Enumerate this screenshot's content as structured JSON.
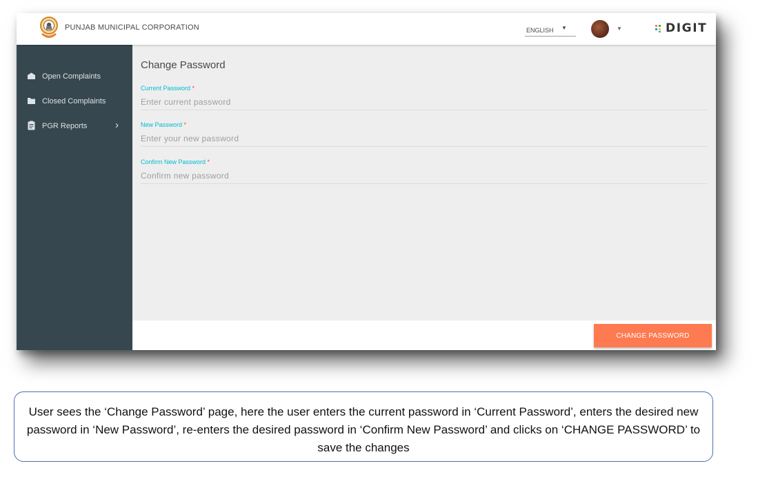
{
  "header": {
    "corporation_name": "PUNJAB MUNICIPAL CORPORATION",
    "language": "ENGLISH",
    "brand": "DIGIT"
  },
  "sidebar": {
    "items": [
      {
        "label": "Open Complaints",
        "icon": "envelope-open-icon"
      },
      {
        "label": "Closed Complaints",
        "icon": "folder-icon"
      },
      {
        "label": "PGR Reports",
        "icon": "clipboard-icon"
      }
    ]
  },
  "main": {
    "title": "Change Password",
    "fields": [
      {
        "label": "Current Password",
        "required_mark": "*",
        "placeholder": "Enter current password",
        "value": ""
      },
      {
        "label": "New Password",
        "required_mark": "*",
        "placeholder": "Enter your new password",
        "value": ""
      },
      {
        "label": "Confirm New Password",
        "required_mark": "*",
        "placeholder": "Confirm new password",
        "value": ""
      }
    ],
    "submit_label": "CHANGE PASSWORD"
  },
  "caption": {
    "text": "User sees the ‘Change Password’ page, here the user enters the current password in ‘Current Password’, enters the desired new password in ‘New Password’, re-enters the desired password in ‘Confirm New Password’ and clicks on ‘CHANGE PASSWORD’ to save the changes"
  },
  "colors": {
    "sidebar_bg": "#37474f",
    "accent_label": "#00bcd1",
    "button_bg": "#fe7a51",
    "required": "#f44336",
    "caption_border": "#4a6fb5"
  }
}
